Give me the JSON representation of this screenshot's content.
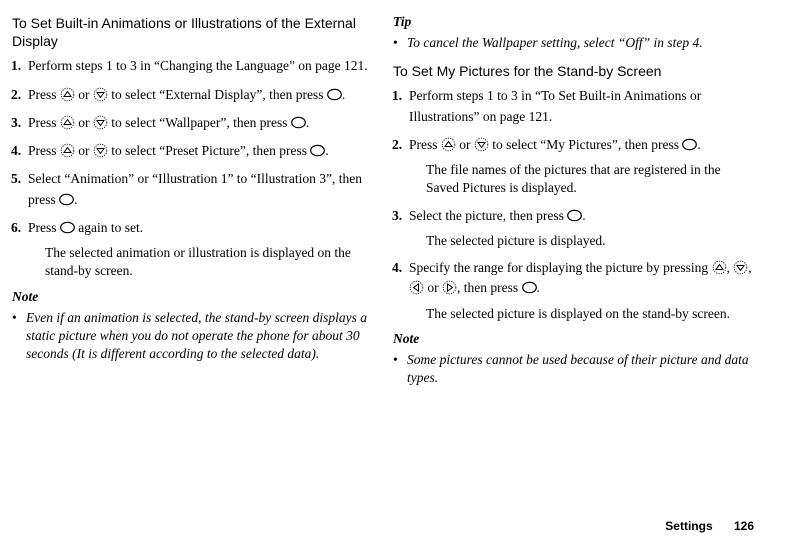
{
  "left": {
    "heading": "To Set Built-in Animations or Illustrations of the External Display",
    "steps": [
      {
        "num": "1.",
        "pre": "Perform steps 1 to 3 in “Changing the Language” on page 121."
      },
      {
        "num": "2.",
        "pre": "Press ",
        "b1": "up",
        "mid1": " or ",
        "b2": "down",
        "mid2": " to select “External Display”, then press ",
        "b3": "ok",
        "post": "."
      },
      {
        "num": "3.",
        "pre": "Press ",
        "b1": "up",
        "mid1": " or ",
        "b2": "down",
        "mid2": " to select “Wallpaper”, then press ",
        "b3": "ok",
        "post": "."
      },
      {
        "num": "4.",
        "pre": "Press ",
        "b1": "up",
        "mid1": " or ",
        "b2": "down",
        "mid2": " to select “Preset Picture”, then press ",
        "b3": "ok",
        "post": "."
      },
      {
        "num": "5.",
        "pre": "Select “Animation” or “Illustration 1” to “Illustration 3”, then press ",
        "b1": "ok",
        "post": "."
      },
      {
        "num": "6.",
        "pre": "Press ",
        "b1": "ok",
        "post": " again to set.",
        "after": "The selected animation or illustration is displayed on the stand-by screen."
      }
    ],
    "noteHead": "Note",
    "noteBody": "Even if an animation is selected, the stand-by screen displays a static picture when you do not operate the phone for about 30 seconds (It is different according to the selected data)."
  },
  "right": {
    "tipHead": "Tip",
    "tipBody": "To cancel the Wallpaper setting, select “Off” in step 4.",
    "heading": "To Set My Pictures for the Stand-by Screen",
    "steps": [
      {
        "num": "1.",
        "pre": "Perform steps 1 to 3 in “To Set Built-in Animations or Illustrations” on page 121."
      },
      {
        "num": "2.",
        "pre": "Press ",
        "b1": "up",
        "mid1": " or ",
        "b2": "down",
        "mid2": " to select “My Pictures”, then press ",
        "b3": "ok",
        "post": ".",
        "after": "The file names of the pictures that are registered in the Saved Pictures is displayed."
      },
      {
        "num": "3.",
        "pre": "Select the picture, then press ",
        "b1": "ok",
        "post": ".",
        "after": "The selected picture is displayed."
      },
      {
        "num": "4.",
        "pre": "Specify the range for displaying the picture by pressing ",
        "b1": "up",
        "mid1": ", ",
        "b2": "down",
        "mid2": ", ",
        "b3": "left",
        "mid3": " or ",
        "b4": "right",
        "mid4": ", then press ",
        "b5": "ok",
        "post": ".",
        "after": "The selected picture is displayed on the stand-by screen."
      }
    ],
    "noteHead": "Note",
    "noteBody": "Some pictures cannot be used because of their picture and data types."
  },
  "footer": {
    "section": "Settings",
    "page": "126"
  }
}
